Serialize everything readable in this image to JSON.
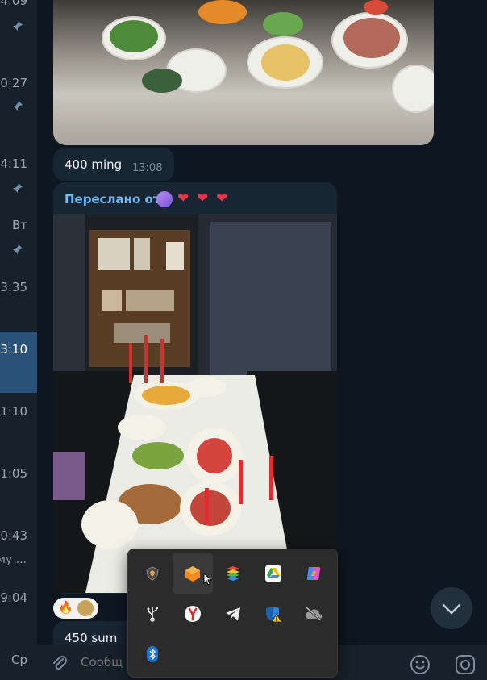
{
  "sidebar": {
    "items": [
      {
        "time": "4:09",
        "pinned": true,
        "active": false
      },
      {
        "time": "0:27",
        "pinned": true,
        "active": false
      },
      {
        "time": "4:11",
        "pinned": true,
        "active": false
      },
      {
        "time": "Вт",
        "pinned": true,
        "active": false
      },
      {
        "time": "3:35",
        "pinned": false,
        "active": false
      },
      {
        "time": "3:10",
        "pinned": false,
        "active": true
      },
      {
        "time": "1:10",
        "pinned": false,
        "active": false
      },
      {
        "time": "1:05",
        "pinned": false,
        "active": false
      },
      {
        "time": "0:43",
        "pinned": false,
        "active": false
      },
      {
        "time": "9:04",
        "pinned": false,
        "active": false
      },
      {
        "time": "Ср",
        "pinned": false,
        "active": false
      }
    ],
    "snippet": "му ..."
  },
  "messages": {
    "msg1": {
      "text": "400 ming",
      "time": "13:08"
    },
    "forwarded": {
      "label": "Переслано от"
    },
    "msg2": {
      "text": "450 sum"
    }
  },
  "reactions": [
    {
      "emoji": "🔥"
    }
  ],
  "composer": {
    "placeholder": "Сообщ"
  },
  "tray": {
    "icons": [
      {
        "name": "shield-app-icon"
      },
      {
        "name": "orange-box-app-icon"
      },
      {
        "name": "bluestacks-icon"
      },
      {
        "name": "google-drive-icon"
      },
      {
        "name": "copilot-icon"
      },
      {
        "name": "usb-icon"
      },
      {
        "name": "yandex-browser-icon"
      },
      {
        "name": "telegram-icon"
      },
      {
        "name": "windows-security-warning-icon"
      },
      {
        "name": "onedrive-offline-icon"
      },
      {
        "name": "bluetooth-icon"
      }
    ]
  },
  "colors": {
    "accent": "#71baf2",
    "active_chat": "#2b5278",
    "bubble": "#182533",
    "background": "#0e1621"
  }
}
